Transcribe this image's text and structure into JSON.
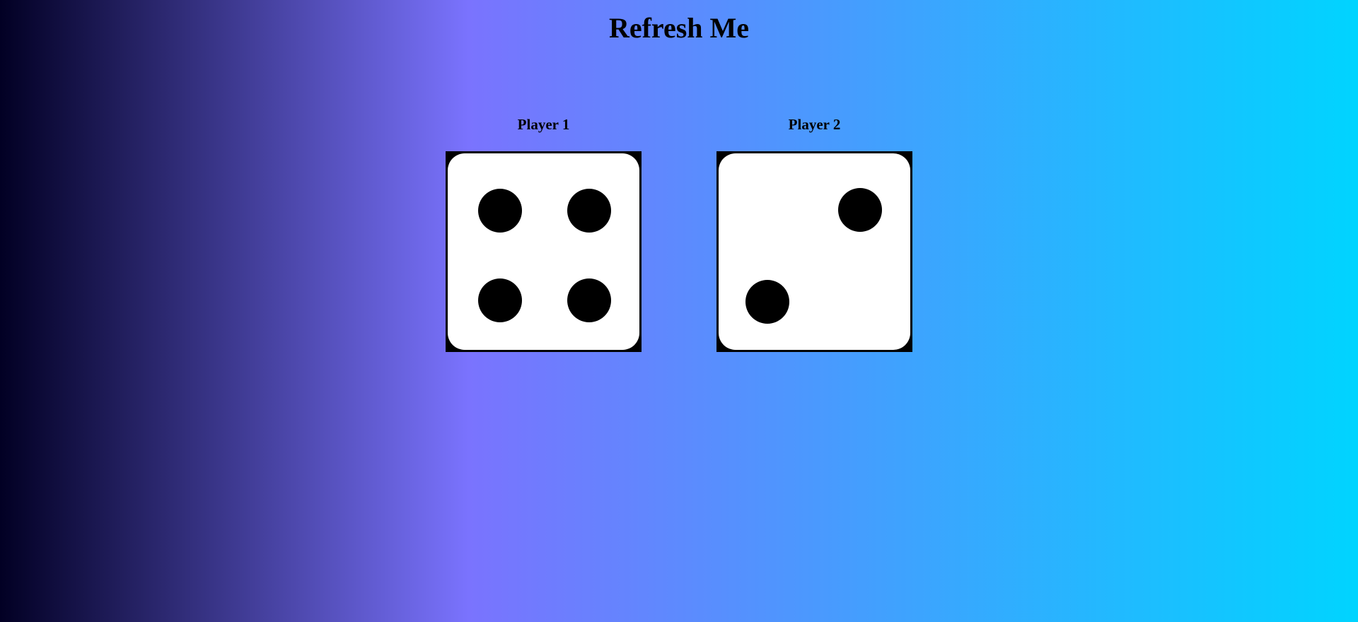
{
  "page": {
    "title": "Refresh Me",
    "background_gradient": [
      "#020024",
      "#7a73fe",
      "#00d4ff"
    ]
  },
  "players": [
    {
      "label": "Player 1",
      "die_value": 4
    },
    {
      "label": "Player 2",
      "die_value": 2
    }
  ],
  "dice": {
    "face_color": "#ffffff",
    "pip_color": "#000000",
    "border_color": "#000000"
  }
}
